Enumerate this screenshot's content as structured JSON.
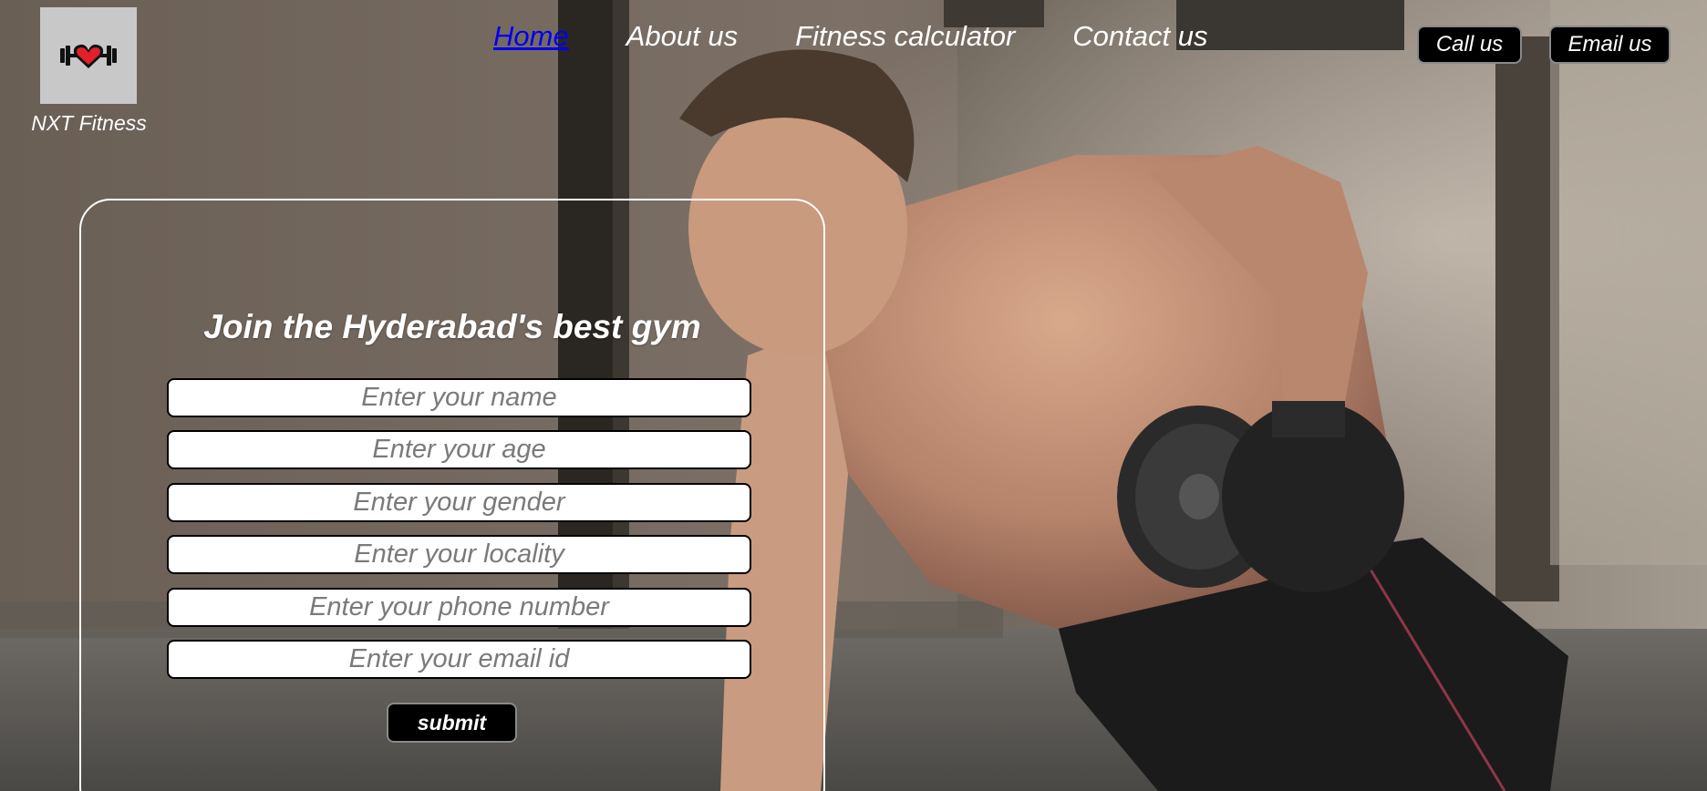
{
  "brand": {
    "name": "NXT Fitness",
    "logo_icon": "dumbbell-heart-icon"
  },
  "nav": {
    "items": [
      {
        "label": "Home",
        "active": true
      },
      {
        "label": "About us",
        "active": false
      },
      {
        "label": "Fitness calculator",
        "active": false
      },
      {
        "label": "Contact us",
        "active": false
      }
    ]
  },
  "actions": {
    "call_label": "Call us",
    "email_label": "Email us"
  },
  "form": {
    "title": "Join the Hyderabad's best gym",
    "fields": [
      {
        "placeholder": "Enter your name",
        "value": ""
      },
      {
        "placeholder": "Enter your age",
        "value": ""
      },
      {
        "placeholder": "Enter your gender",
        "value": ""
      },
      {
        "placeholder": "Enter your locality",
        "value": ""
      },
      {
        "placeholder": "Enter your phone number",
        "value": ""
      },
      {
        "placeholder": "Enter your email id",
        "value": ""
      }
    ],
    "submit_label": "submit"
  },
  "colors": {
    "active_link": "#0000ee",
    "button_bg": "#000000",
    "text_light": "#ffffff"
  }
}
